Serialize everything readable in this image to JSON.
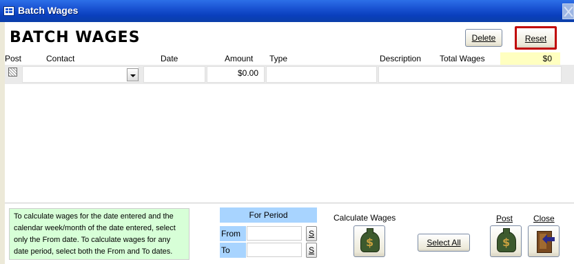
{
  "window": {
    "title": "Batch Wages"
  },
  "header": {
    "page_title": "BATCH WAGES",
    "delete_label": "Delete",
    "reset_label": "Reset"
  },
  "columns": {
    "post": "Post",
    "contact": "Contact",
    "date": "Date",
    "amount": "Amount",
    "type": "Type",
    "description": "Description",
    "total_wages": "Total Wages"
  },
  "totals": {
    "total_wages_value": "$0"
  },
  "row": {
    "contact": "",
    "date": "",
    "amount": "$0.00",
    "type": "",
    "description": ""
  },
  "footer": {
    "info_text": "To calculate wages for the date entered and the calendar week/month of the date entered, select only the From date. To calculate wages for any date period, select both the From and To dates.",
    "period_header": "For Period",
    "from_label": "From",
    "to_label": "To",
    "from_value": "",
    "to_value": "",
    "s_button": "S",
    "calculate_label": "Calculate Wages",
    "select_all_label": "Select All",
    "post_label": "Post",
    "close_label": "Close"
  },
  "icons": {
    "app": "form-icon",
    "calculate": "money-bag-icon",
    "post": "money-bag-icon",
    "close": "exit-door-icon",
    "title_close": "close-icon",
    "dropdown": "chevron-down-icon"
  },
  "colors": {
    "reset_border": "#c00000",
    "total_bg": "#ffffc0",
    "info_bg": "#d7ffd7",
    "period_bg": "#a8d4ff"
  }
}
